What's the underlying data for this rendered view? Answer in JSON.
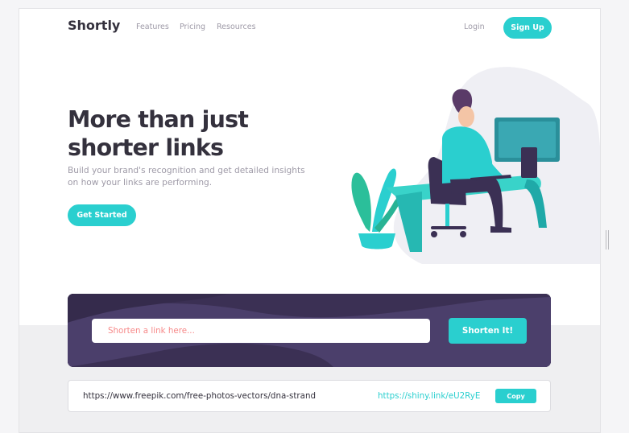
{
  "header": {
    "logo": "Shortly",
    "nav": [
      "Features",
      "Pricing",
      "Resources"
    ],
    "login": "Login",
    "signup": "Sign Up"
  },
  "hero": {
    "title": "More than just shorter links",
    "subtitle": "Build your brand's recognition and get detailed insights on how your links are performing.",
    "cta": "Get Started",
    "illustration": "person-working-at-desk-illustration"
  },
  "shorten": {
    "placeholder": "Shorten a link here...",
    "button": "Shorten It!"
  },
  "result": {
    "original": "https://www.freepik.com/free-photos-vectors/dna-strand",
    "short": "https://shiny.link/eU2RyE",
    "copy": "Copy"
  },
  "colors": {
    "cyan": "#2acfcf",
    "dark_violet": "#3b3054",
    "red_placeholder": "#f46262",
    "grayish_violet": "#9e9aa7"
  }
}
